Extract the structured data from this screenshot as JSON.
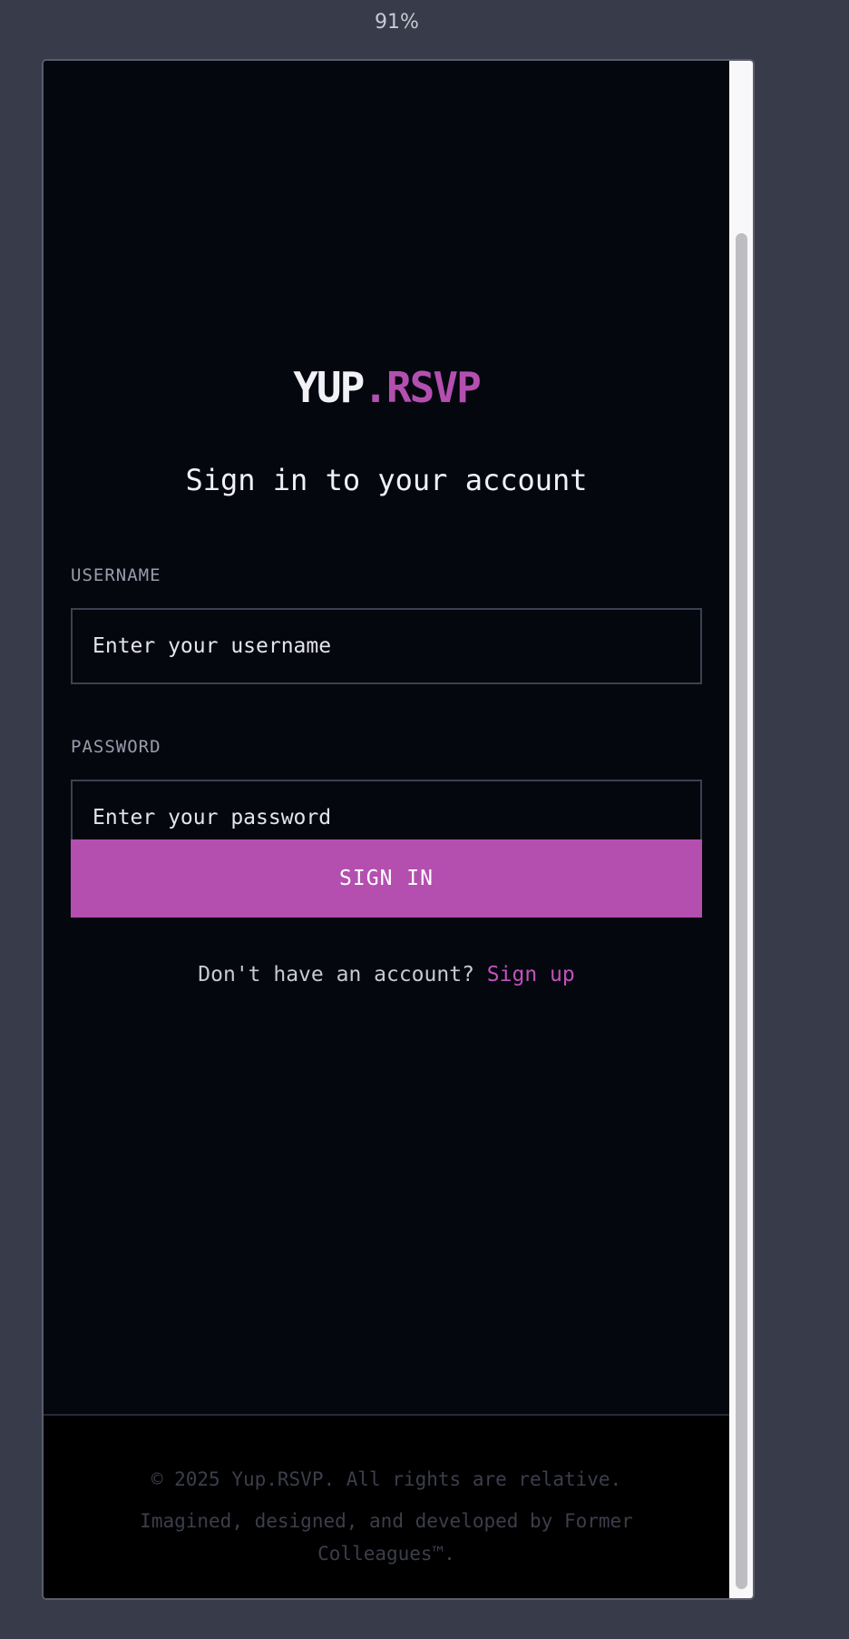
{
  "browser": {
    "zoom_level": "91%"
  },
  "brand": {
    "logo_main": "YUP",
    "logo_accent": ".RSVP",
    "accent_color": "#b44fb0"
  },
  "login": {
    "heading": "Sign in to your account",
    "username_label": "USERNAME",
    "username_placeholder": "Enter your username",
    "username_value": "",
    "password_label": "PASSWORD",
    "password_placeholder": "Enter your password",
    "password_value": "",
    "submit_label": "SIGN IN",
    "signup_prompt": "Don't have an account? ",
    "signup_link": "Sign up"
  },
  "footer": {
    "copyright": "© 2025 Yup.RSVP. All rights are relative.",
    "credits": "Imagined, designed, and developed by Former Colleagues™."
  }
}
